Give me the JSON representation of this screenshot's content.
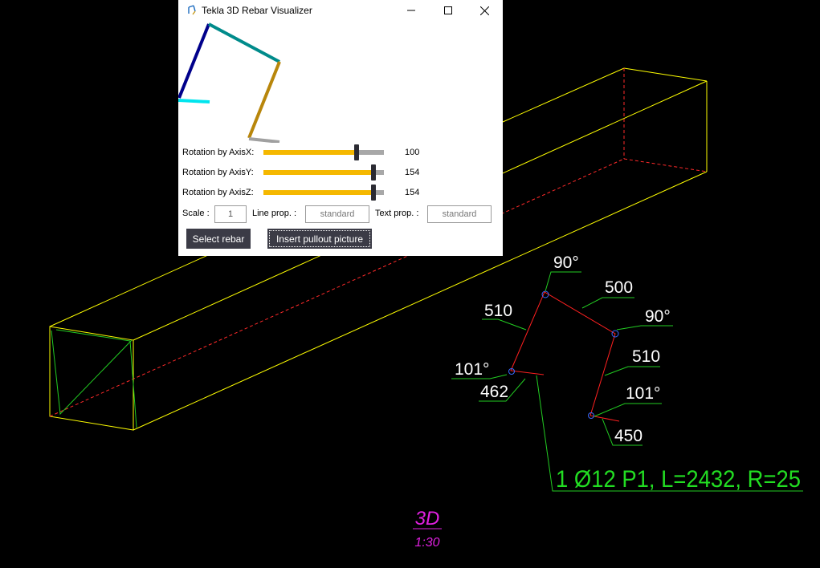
{
  "window": {
    "title": "Tekla 3D Rebar Visualizer",
    "controls": [
      "minimize",
      "maximize",
      "close"
    ]
  },
  "sliders": [
    {
      "label": "Rotation by AxisX:",
      "value": "100",
      "fraction": 0.77
    },
    {
      "label": "Rotation by AxisY:",
      "value": "154",
      "fraction": 0.91
    },
    {
      "label": "Rotation by AxisZ:",
      "value": "154",
      "fraction": 0.91
    }
  ],
  "fields": {
    "scale_label": "Scale :",
    "scale_value": "1",
    "line_prop_label": "Line prop. :",
    "line_prop_value": "standard",
    "text_prop_label": "Text prop. :",
    "text_prop_value": "standard"
  },
  "buttons": {
    "select_rebar": "Select rebar",
    "insert_pullout": "Insert pullout picture"
  },
  "drawing": {
    "dims": {
      "angle_top": "90°",
      "seg_top": "500",
      "angle_right": "90°",
      "seg_left": "510",
      "seg_right": "510",
      "angle_left": "101°",
      "angle_bottom_right": "101°",
      "hook_left": "462",
      "hook_right": "450"
    },
    "rebar_label": "1 Ø12 P1, L=2432, R=25",
    "view_name": "3D",
    "view_scale": "1:30",
    "colors": {
      "outline": "#ffff00",
      "section": "#00cc00",
      "rebar": "#ff0000",
      "dimension_text": "#ffffff",
      "leader": "#00cc00",
      "label": "#22dd22",
      "view_title": "#e020e0",
      "bend_marker": "#3a6aff"
    }
  },
  "preview_colors": [
    "#00008b",
    "#008b8b",
    "#b8860b",
    "#a0a0a0",
    "#00e5ee"
  ]
}
